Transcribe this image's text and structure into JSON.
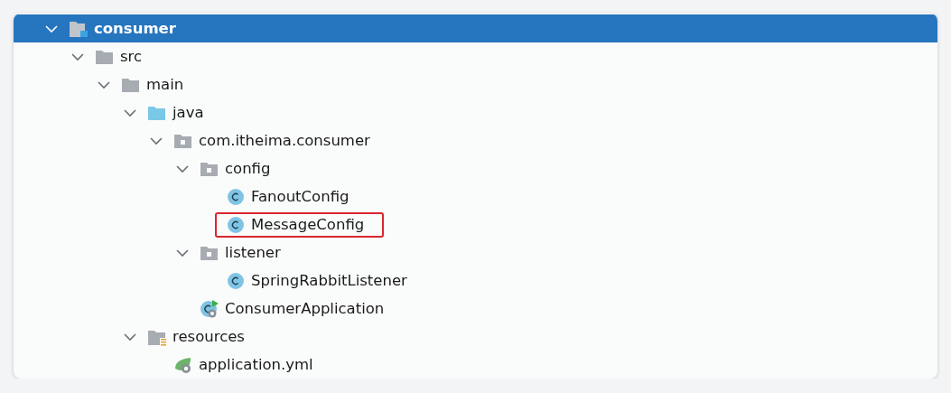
{
  "project_tree": [
    {
      "label": "consumer",
      "kind": "module",
      "expanded": true,
      "selected": true,
      "highlighted": false,
      "children": [
        {
          "label": "src",
          "kind": "folder",
          "expanded": true,
          "selected": false,
          "highlighted": false,
          "children": [
            {
              "label": "main",
              "kind": "folder",
              "expanded": true,
              "selected": false,
              "highlighted": false,
              "children": [
                {
                  "label": "java",
                  "kind": "source-folder",
                  "expanded": true,
                  "selected": false,
                  "highlighted": false,
                  "children": [
                    {
                      "label": "com.itheima.consumer",
                      "kind": "package",
                      "expanded": true,
                      "selected": false,
                      "highlighted": false,
                      "children": [
                        {
                          "label": "config",
                          "kind": "package",
                          "expanded": true,
                          "selected": false,
                          "highlighted": false,
                          "children": [
                            {
                              "label": "FanoutConfig",
                              "kind": "class",
                              "selected": false,
                              "highlighted": false
                            },
                            {
                              "label": "MessageConfig",
                              "kind": "class",
                              "selected": false,
                              "highlighted": true
                            }
                          ]
                        },
                        {
                          "label": "listener",
                          "kind": "package",
                          "expanded": true,
                          "selected": false,
                          "highlighted": false,
                          "children": [
                            {
                              "label": "SpringRabbitListener",
                              "kind": "class",
                              "selected": false,
                              "highlighted": false
                            }
                          ]
                        },
                        {
                          "label": "ConsumerApplication",
                          "kind": "app-class",
                          "selected": false,
                          "highlighted": false
                        }
                      ]
                    }
                  ]
                },
                {
                  "label": "resources",
                  "kind": "resources",
                  "expanded": true,
                  "selected": false,
                  "highlighted": false,
                  "children": [
                    {
                      "label": "application.yml",
                      "kind": "yml",
                      "selected": false,
                      "highlighted": false
                    }
                  ]
                }
              ]
            }
          ]
        }
      ]
    }
  ]
}
